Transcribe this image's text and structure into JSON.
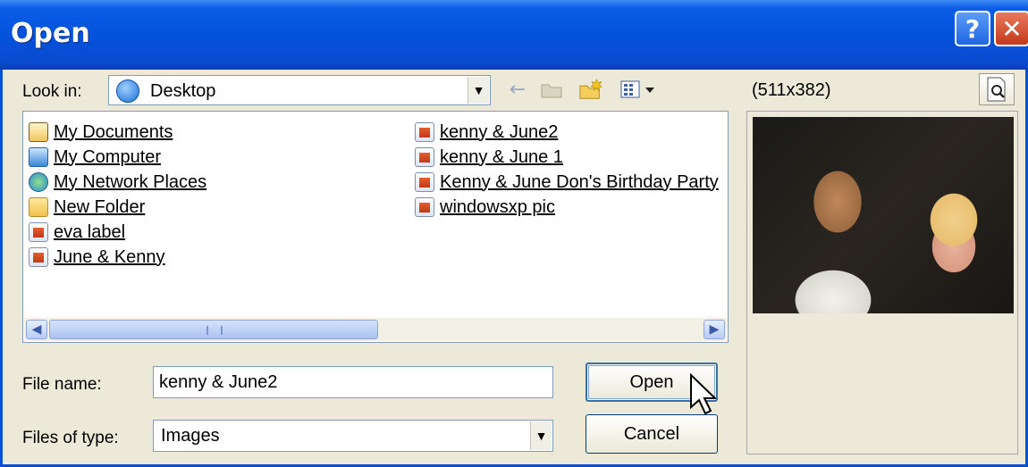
{
  "window": {
    "title": "Open"
  },
  "titlebar": {
    "help_label": "?",
    "close_label": "✕"
  },
  "toolbar": {
    "look_in_label": "Look in:",
    "look_in_value": "Desktop",
    "icons": [
      "back-arrow-icon",
      "up-folder-icon",
      "new-folder-icon",
      "view-menu-icon"
    ]
  },
  "file_list": {
    "items": [
      {
        "name": "My Documents",
        "icon": "my-documents-icon"
      },
      {
        "name": "My Computer",
        "icon": "my-computer-icon"
      },
      {
        "name": "My Network Places",
        "icon": "network-places-icon"
      },
      {
        "name": "New Folder",
        "icon": "folder-icon"
      },
      {
        "name": "eva label",
        "icon": "image-file-icon"
      },
      {
        "name": "June & Kenny",
        "icon": "image-file-icon"
      },
      {
        "name": "kenny & June2",
        "icon": "image-file-icon"
      },
      {
        "name": "kenny & June 1",
        "icon": "image-file-icon"
      },
      {
        "name": "Kenny & June Don's Birthday Party",
        "icon": "image-file-icon"
      },
      {
        "name": "windowsxp pic",
        "icon": "image-file-icon"
      }
    ]
  },
  "form": {
    "file_name_label": "File name:",
    "file_name_value": "kenny & June2",
    "files_of_type_label": "Files of type:",
    "files_of_type_value": "Images",
    "open_label": "Open",
    "cancel_label": "Cancel"
  },
  "preview": {
    "size_text": "(511x382)"
  },
  "colors": {
    "titlebar": "#0453dd",
    "dialog_bg": "#ece9d8",
    "close": "#c4391c"
  }
}
